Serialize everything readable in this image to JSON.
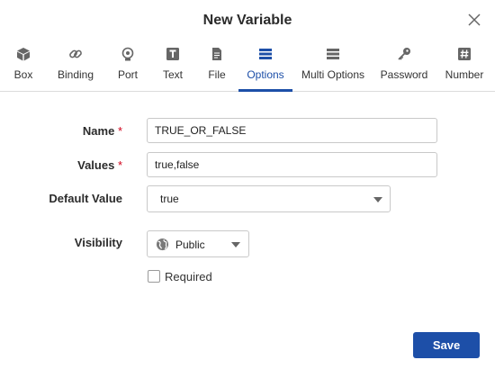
{
  "dialog": {
    "title": "New Variable"
  },
  "tabs": [
    {
      "label": "Box",
      "icon": "box-icon"
    },
    {
      "label": "Binding",
      "icon": "link-icon"
    },
    {
      "label": "Port",
      "icon": "port-icon"
    },
    {
      "label": "Text",
      "icon": "text-icon"
    },
    {
      "label": "File",
      "icon": "file-icon"
    },
    {
      "label": "Options",
      "icon": "options-icon",
      "active": true
    },
    {
      "label": "Multi Options",
      "icon": "multi-options-icon"
    },
    {
      "label": "Password",
      "icon": "key-icon"
    },
    {
      "label": "Number",
      "icon": "hash-icon"
    }
  ],
  "form": {
    "name": {
      "label": "Name",
      "required_mark": "*",
      "value": "TRUE_OR_FALSE"
    },
    "values": {
      "label": "Values",
      "required_mark": "*",
      "value": "true,false"
    },
    "default": {
      "label": "Default Value",
      "value": "true"
    },
    "visibility": {
      "label": "Visibility",
      "value": "Public"
    },
    "required": {
      "label": "Required",
      "checked": false
    }
  },
  "footer": {
    "save_label": "Save"
  },
  "colors": {
    "accent": "#1d4fa8",
    "required": "#d0021b"
  }
}
